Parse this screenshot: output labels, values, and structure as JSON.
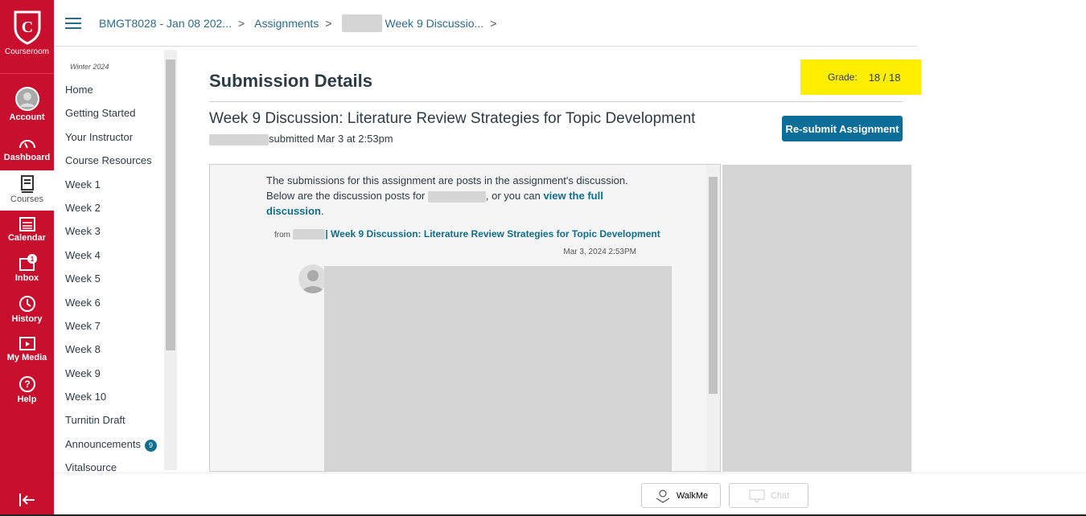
{
  "global_nav": {
    "logo": "Courseroom",
    "items": [
      {
        "label": "Account",
        "icon": "user-icon"
      },
      {
        "label": "Dashboard",
        "icon": "dashboard-icon"
      },
      {
        "label": "Courses",
        "icon": "book-icon",
        "active": true
      },
      {
        "label": "Calendar",
        "icon": "calendar-icon"
      },
      {
        "label": "Inbox",
        "icon": "inbox-icon",
        "badge": "1"
      },
      {
        "label": "History",
        "icon": "clock-icon"
      },
      {
        "label": "My Media",
        "icon": "media-icon"
      },
      {
        "label": "Help",
        "icon": "help-icon"
      }
    ],
    "collapse_icon": "collapse-arrow-icon"
  },
  "breadcrumb": [
    "BMGT8028 - Jan 08 202...",
    "Assignments",
    "Week 9 Discussio..."
  ],
  "course_nav": {
    "term": "Winter 2024",
    "items": [
      "Home",
      "Getting Started",
      "Your Instructor",
      "Course Resources",
      "Week 1",
      "Week 2",
      "Week 3",
      "Week 4",
      "Week 5",
      "Week 6",
      "Week 7",
      "Week 8",
      "Week 9",
      "Week 10",
      "Turnitin Draft",
      "Announcements",
      "Vitalsource"
    ],
    "announcements_badge": "9"
  },
  "main": {
    "title": "Submission Details",
    "grade_label": "Grade:",
    "grade_value": "18 / 18",
    "assignment_title": "Week 9 Discussion: Literature Review Strategies for Topic Development",
    "submitted": "submitted Mar 3 at 2:53pm",
    "resubmit": "Re-submit Assignment",
    "intro_1": "The submissions for this assignment are posts in the assignment's discussion. Below are the discussion posts for ",
    "intro_2": ", or you can ",
    "intro_link": "view the full discussion",
    "intro_end": ".",
    "from": "from",
    "post_link": "| Week 9 Discussion: Literature Review Strategies for Topic Development",
    "post_date": "Mar 3, 2024 2:53PM",
    "highlight_color": "#ffee00",
    "accent": "#0b6e99"
  },
  "bottom": {
    "walkme": "WalkMe",
    "chat": "Chat"
  }
}
